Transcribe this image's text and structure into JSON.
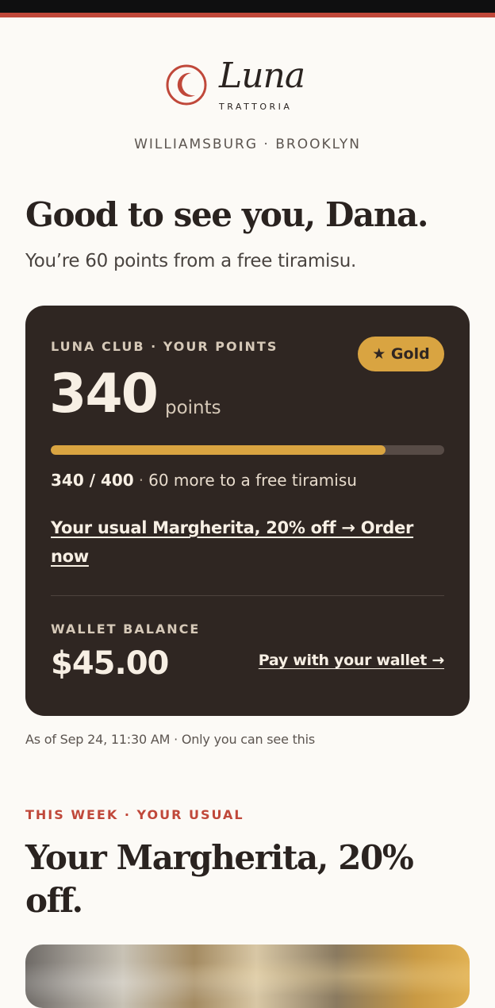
{
  "brand": {
    "name": "Luna",
    "subtitle": "TRATTORIA",
    "location": "WILLIAMSBURG · BROOKLYN",
    "accent_color": "#c0483a"
  },
  "greeting": {
    "title": "Good to see you, Dana.",
    "subtitle": "You’re 60 points from a free tiramisu."
  },
  "loyalty_card": {
    "label": "LUNA CLUB · YOUR POINTS",
    "tier_badge": "★ Gold",
    "points": "340",
    "points_unit": "points",
    "progress_fraction": 0.85,
    "progress_current": "340 / 400",
    "progress_separator": "·",
    "progress_caption": "60 more to a free tiramisu",
    "order_link": "Your usual Margherita, 20% off → Order now",
    "wallet_label": "WALLET BALANCE",
    "wallet_amount": "$45.00",
    "wallet_link": "Pay with your wallet →"
  },
  "as_of": "As of Sep 24, 11:30 AM · Only you can see this",
  "promo": {
    "eyebrow": "THIS WEEK · YOUR USUAL",
    "title": "Your Margherita, 20% off."
  }
}
